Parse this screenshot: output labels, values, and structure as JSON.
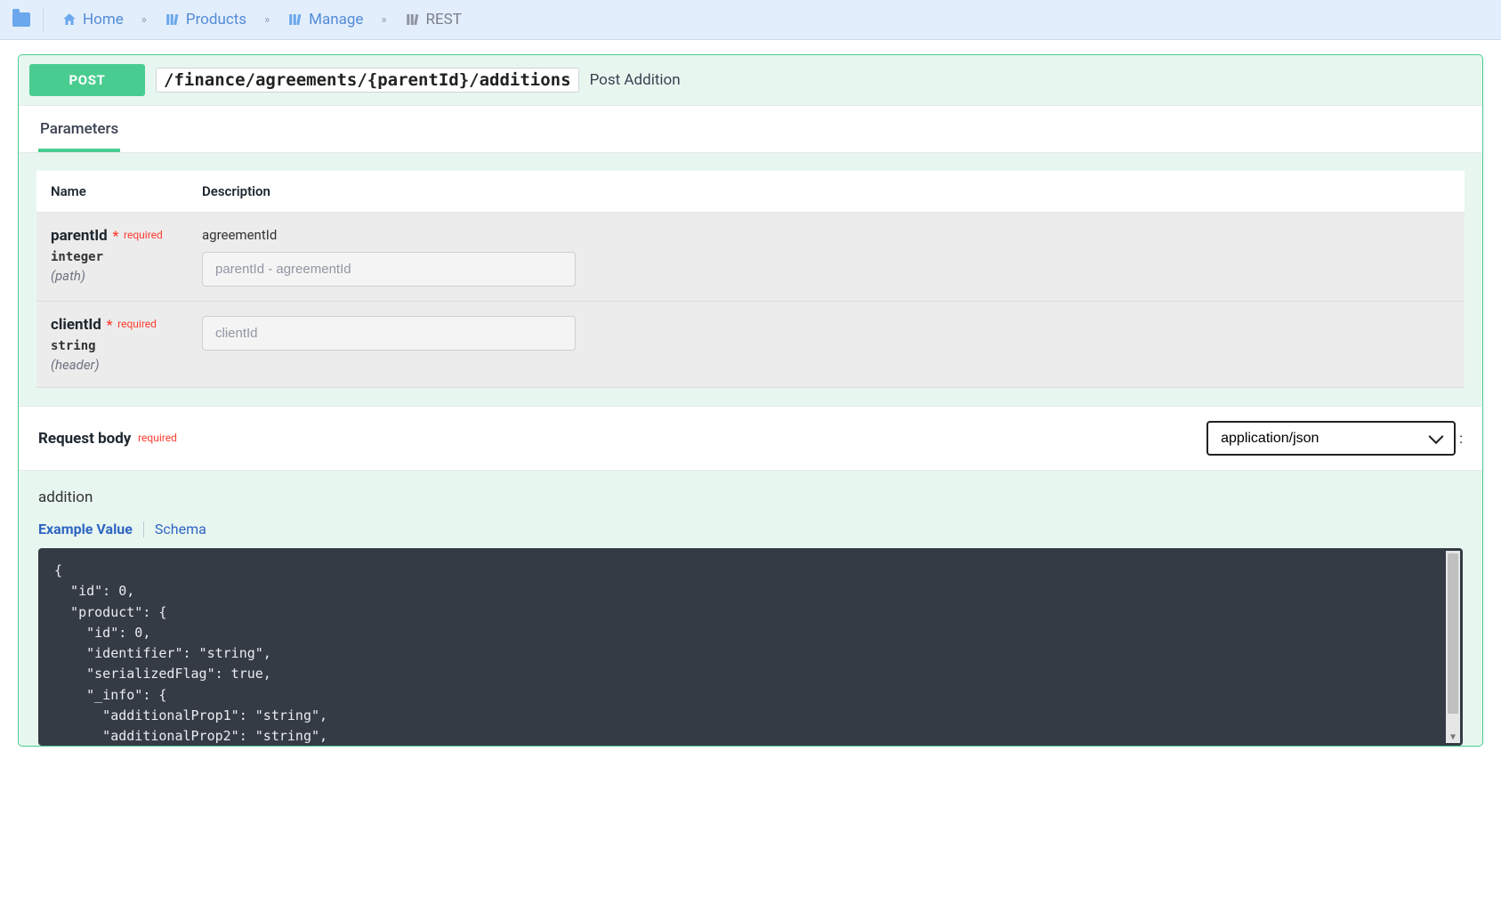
{
  "breadcrumb": {
    "home": "Home",
    "products": "Products",
    "manage": "Manage",
    "rest": "REST"
  },
  "op": {
    "method": "POST",
    "path": "/finance/agreements/{parentId}/additions",
    "summary": "Post Addition"
  },
  "tabs": {
    "parameters": "Parameters"
  },
  "params": {
    "headers": {
      "name": "Name",
      "description": "Description"
    },
    "required_star": "*",
    "required_label": "required",
    "rows": [
      {
        "name": "parentId",
        "type": "integer",
        "in": "(path)",
        "desc": "agreementId",
        "placeholder": "parentId - agreementId"
      },
      {
        "name": "clientId",
        "type": "string",
        "in": "(header)",
        "desc": "",
        "placeholder": "clientId"
      }
    ]
  },
  "request_body": {
    "title": "Request body",
    "required_label": "required",
    "content_type": "application/json",
    "desc": "addition",
    "example_tab": "Example Value",
    "schema_tab": "Schema",
    "example": "{\n  \"id\": 0,\n  \"product\": {\n    \"id\": 0,\n    \"identifier\": \"string\",\n    \"serializedFlag\": true,\n    \"_info\": {\n      \"additionalProp1\": \"string\",\n      \"additionalProp2\": \"string\","
  }
}
